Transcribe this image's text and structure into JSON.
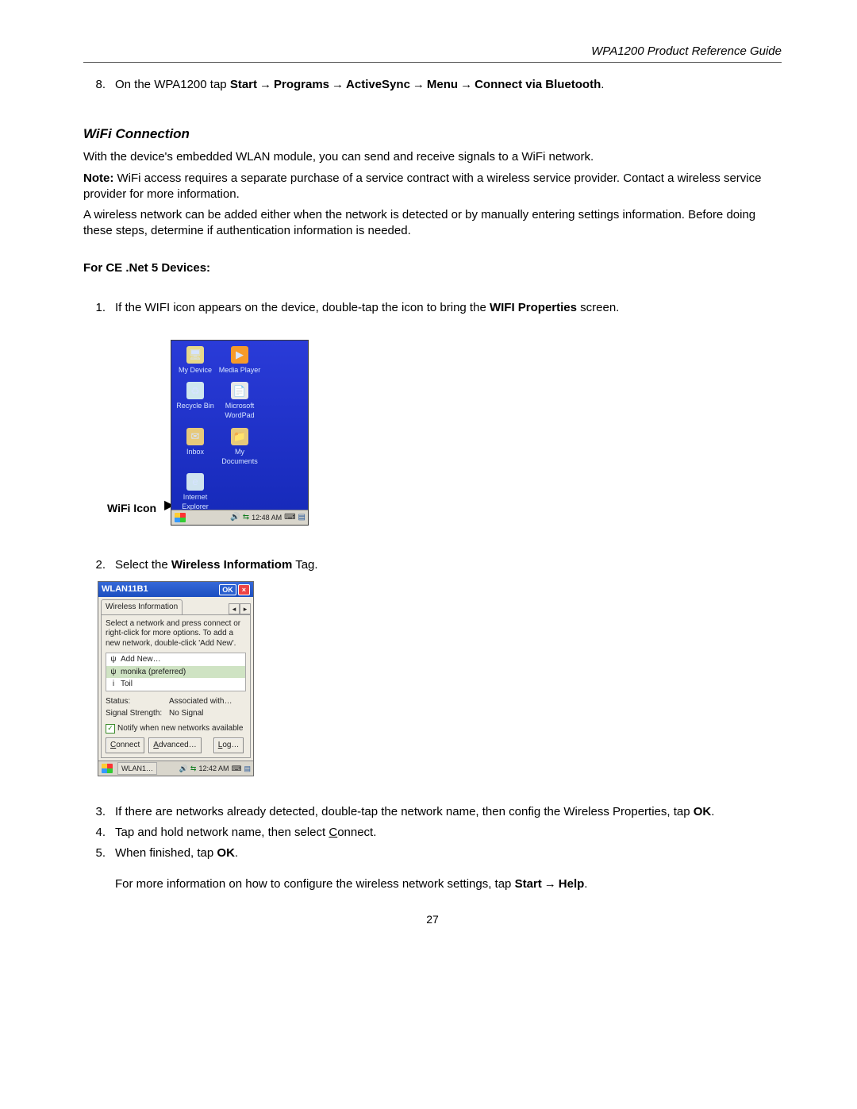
{
  "header": {
    "title": "WPA1200 Product Reference Guide"
  },
  "arrow": "→",
  "step8": {
    "num": "8.",
    "pre": "On the WPA1200 tap ",
    "p1": "Start",
    "p2": "Programs",
    "p3": "ActiveSync",
    "p4": "Menu",
    "p5": "Connect via Bluetooth",
    "tail": "."
  },
  "section_title": "WiFi Connection",
  "para1": "With the device's embedded WLAN module, you can send and receive signals to a WiFi network.",
  "note_label": "Note:",
  "note_body": " WiFi access requires a separate purchase of a service contract with a wireless service provider. Contact a wireless service provider for more information.",
  "para2": "A wireless network can be added either when the network is detected or by manually entering settings information. Before doing these steps, determine if authentication information is needed.",
  "sub_heading": "For CE .Net 5 Devices:",
  "step1": {
    "num": "1.",
    "pre": "If the WIFI icon appears on the device, double-tap the icon to bring the ",
    "bold": "WIFI Properties",
    "tail": " screen."
  },
  "wifi_icon_label": "WiFi Icon",
  "desktop": {
    "icons": [
      {
        "label": "My Device",
        "glyph": "🖥",
        "bg": "#e7d98a"
      },
      {
        "label": "Media Player",
        "glyph": "▶",
        "bg": "#f79a2a"
      },
      {
        "label": "Recycle Bin",
        "glyph": "♻",
        "bg": "#cfe7ef"
      },
      {
        "label": "Microsoft WordPad",
        "glyph": "📄",
        "bg": "#e7e7e7"
      },
      {
        "label": "Inbox",
        "glyph": "✉",
        "bg": "#e7c97a"
      },
      {
        "label": "My Documents",
        "glyph": "📁",
        "bg": "#e7c97a"
      },
      {
        "label": "Internet Explorer",
        "glyph": "e",
        "bg": "#cfe3ef"
      }
    ],
    "time": "12:48 AM"
  },
  "step2": {
    "num": "2.",
    "pre": "Select the ",
    "bold": "Wireless Informatiom",
    "tail": " Tag."
  },
  "wlan": {
    "title": "WLAN11B1",
    "ok": "OK",
    "tab": "Wireless Information",
    "instr": "Select a network and press connect or right-click for more options.  To add a new network, double-click 'Add New'.",
    "items": [
      {
        "icon": "ψ",
        "label": "Add New…",
        "sel": false
      },
      {
        "icon": "ψ",
        "label": "monika (preferred)",
        "sel": true
      },
      {
        "icon": "i",
        "label": "Toil",
        "sel": false
      }
    ],
    "status_lab": "Status:",
    "status_val": "Associated with…",
    "signal_lab": "Signal Strength:",
    "signal_val": "No Signal",
    "notify": "Notify when new networks available",
    "btn_connect": "Connect",
    "btn_advanced": "Advanced…",
    "btn_log": "Log…",
    "task_app": "WLAN1…",
    "task_time": "12:42 AM"
  },
  "step3": {
    "num": "3.",
    "pre": "If there are networks already detected, double-tap the network name, then config the Wireless Properties, tap ",
    "bold": "OK",
    "tail": "."
  },
  "step4": {
    "num": "4.",
    "text": "Tap and hold network name, then select ",
    "c": "C",
    "onnect": "onnect."
  },
  "step5": {
    "num": "5.",
    "pre": "When finished, tap ",
    "bold": "OK",
    "tail": "."
  },
  "footer_line": {
    "pre": "For more information on how to configure the wireless network settings, tap ",
    "p1": "Start",
    "p2": "Help",
    "tail": "."
  },
  "page_number": "27"
}
